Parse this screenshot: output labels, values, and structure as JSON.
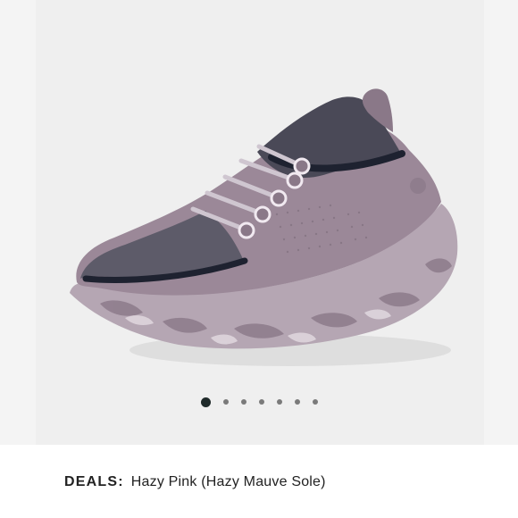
{
  "product": {
    "image_alt": "Trail runner shoe in hazy pink with knit collar and mottled mauve sole",
    "caption_label": "DEALS:",
    "caption_value": "Hazy Pink (Hazy Mauve Sole)"
  },
  "carousel": {
    "dot_count": 7,
    "active_index": 0
  },
  "colors": {
    "upper": "#9b8898",
    "sole": "#b3a4b1",
    "knit": "#5a5866",
    "trim": "#1e2230",
    "active_dot": "#1f2a2a"
  }
}
